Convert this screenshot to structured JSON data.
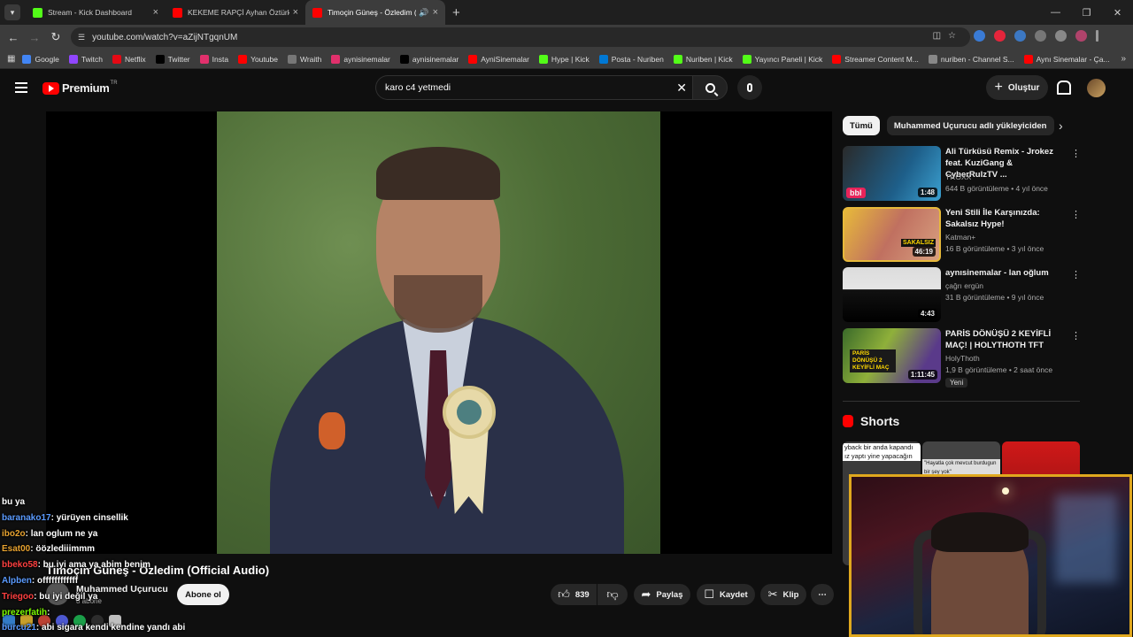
{
  "tabs": [
    {
      "title": "Stream - Kick Dashboard",
      "fav": "#53fc18"
    },
    {
      "title": "KEKEME RAPÇİ Ayhan Öztürk Y",
      "fav": "#ff0000"
    },
    {
      "title": "Timoçin Güneş - Özledim (",
      "fav": "#ff0000",
      "active": true
    }
  ],
  "omnibox": {
    "url": "youtube.com/watch?v=aZijNTgqnUM"
  },
  "bookmarks": [
    {
      "label": "Google",
      "color": "#4285f4"
    },
    {
      "label": "Twitch",
      "color": "#9146ff"
    },
    {
      "label": "Netflix",
      "color": "#e50914"
    },
    {
      "label": "Twitter",
      "color": "#000000"
    },
    {
      "label": "Insta",
      "color": "#e1306c"
    },
    {
      "label": "Youtube",
      "color": "#ff0000"
    },
    {
      "label": "Wraith",
      "color": "#777777"
    },
    {
      "label": "aynisinemalar",
      "color": "#e1306c"
    },
    {
      "label": "aynisinemalar",
      "color": "#000000"
    },
    {
      "label": "AyniSinemalar",
      "color": "#ff0000"
    },
    {
      "label": "Hype | Kick",
      "color": "#53fc18"
    },
    {
      "label": "Posta - Nuriben",
      "color": "#0078d4"
    },
    {
      "label": "Nuriben | Kick",
      "color": "#53fc18"
    },
    {
      "label": "Yayıncı Paneli | Kick",
      "color": "#53fc18"
    },
    {
      "label": "Streamer Content M...",
      "color": "#ff0000"
    },
    {
      "label": "nuriben - Channel S...",
      "color": "#888888"
    },
    {
      "label": "Aynı Sinemalar - Ça...",
      "color": "#ff0000"
    }
  ],
  "header": {
    "premium": "Premium",
    "region": "TR",
    "search": "karo c4 yetmedi",
    "create": "Oluştur"
  },
  "video": {
    "title": "Timoçin Güneş - Özledim (Official Audio)",
    "channel": "Muhammed Uçurucu",
    "subs": "8 abone",
    "subscribe": "Abone ol",
    "likes": "839",
    "share": "Paylaş",
    "save": "Kaydet",
    "clip": "Klip"
  },
  "chips": [
    "Tümü",
    "Muhammed Uçurucu adlı yükleyiciden"
  ],
  "recs": [
    {
      "title": "Ali Türküsü Remix - Jrokez feat. KuziGang & CyberRulzTV ...",
      "channel": "TROXX",
      "meta": "644 B görüntüleme • 4 yıl önce",
      "duration": "1:48",
      "badge": "bbl"
    },
    {
      "title": "Yeni Stili İle Karşınızda: Sakalsız Hype!",
      "channel": "Katman+",
      "meta": "16 B görüntüleme • 3 yıl önce",
      "duration": "46:19",
      "badge": "SAKALSIZ"
    },
    {
      "title": "aynısinemalar - lan oğlum",
      "channel": "çağrı ergün",
      "meta": "31 B görüntüleme • 9 yıl önce",
      "duration": "4:43"
    },
    {
      "title": "PARİS DÖNÜŞÜ 2 KEYİFLİ MAÇ! | HOLYTHOTH TFT",
      "channel": "HolyThoth",
      "meta": "1,9 B görüntüleme • 2 saat önce",
      "duration": "1:11:45",
      "new": "Yeni",
      "badge": "PARİS DÖNÜŞÜ 2 KEYİFLİ MAÇ"
    }
  ],
  "shorts": {
    "title": "Shorts",
    "caps": [
      "yback bir anda kapandı ız yaptı yine yapacağın",
      "\"Hayatla çok mevcut burdugun bir şey yok\""
    ]
  },
  "chat": [
    {
      "user": "",
      "msg": "bu ya",
      "color": "#ffffff"
    },
    {
      "user": "baranako17",
      "msg": ": yürüyen cinsellik",
      "color": "#5b9bff"
    },
    {
      "user": "ibo2o",
      "msg": ": lan oglum ne ya",
      "color": "#e8a330"
    },
    {
      "user": "Esat00",
      "msg": ": öözlediiimmm",
      "color": "#e8a330"
    },
    {
      "user": "bbeko58",
      "msg": ": bu iyi ama ya abim benim",
      "color": "#ff4040"
    },
    {
      "user": "Alpben",
      "msg": ": offffffffffff",
      "color": "#5b9bff"
    },
    {
      "user": "Triegoo",
      "msg": ": bu iyi değil ya",
      "color": "#ff4040"
    },
    {
      "user": "prezerfatih",
      "msg": ":",
      "color": "#7cfc00"
    },
    {
      "user": "burcu21",
      "msg": ": abi sigara kendi kendine yandı abi",
      "color": "#5b9bff"
    }
  ]
}
